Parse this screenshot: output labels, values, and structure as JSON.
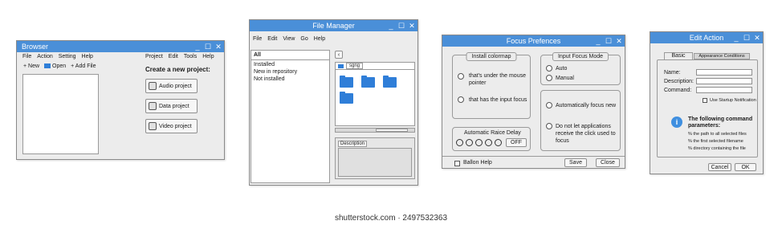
{
  "browser": {
    "title": "Browser",
    "menu": [
      "File",
      "Action",
      "Setting",
      "Help"
    ],
    "toolbar": {
      "new": "New",
      "open": "Open",
      "add_file": "Add File"
    },
    "right_menu": [
      "Project",
      "Edit",
      "Tools",
      "Help"
    ],
    "heading": "Create a new project:",
    "buttons": {
      "audio": "Audio project",
      "data": "Data project",
      "video": "Video project"
    }
  },
  "file_manager": {
    "title": "File Manager",
    "menu": [
      "File",
      "Edit",
      "View",
      "Go",
      "Help"
    ],
    "filters": [
      "All",
      "Installed",
      "New in repository",
      "Not installed"
    ],
    "path": "sgng",
    "description_tab": "Description"
  },
  "focus": {
    "title": "Focus Prefences",
    "colormap_title": "Install colormap",
    "colormap_opts": [
      "that's under the mouse pointer",
      "that has the input focus"
    ],
    "input_mode_title": "Input Focus Mode",
    "input_mode_opts": [
      "Auto",
      "Manual"
    ],
    "auto_focus": "Automatically focus new",
    "no_focus": "Do not let applications receive the click used to focus",
    "raise_delay_title": "Automatic Raice Delay",
    "off": "OFF",
    "balloon": "Ballon Help",
    "save": "Save",
    "close": "Close"
  },
  "edit_action": {
    "title": "Edit Action",
    "tabs": [
      "Basic",
      "Appearance Conditions"
    ],
    "name_label": "Name:",
    "description_label": "Description:",
    "command_label": "Command:",
    "startup": "Use Startup Notification",
    "info_title": "The following command parameters:",
    "params": [
      "the path to all selected files",
      "the first selected filename",
      "directory containing the file"
    ],
    "cancel": "Cancel",
    "ok": "OK"
  },
  "footer": {
    "watermark": "shutterstock.com · 2497532363"
  },
  "colors": {
    "titlebar": "#4a8fd8",
    "folder": "#2f7ed8",
    "window_bg": "#ececec"
  }
}
